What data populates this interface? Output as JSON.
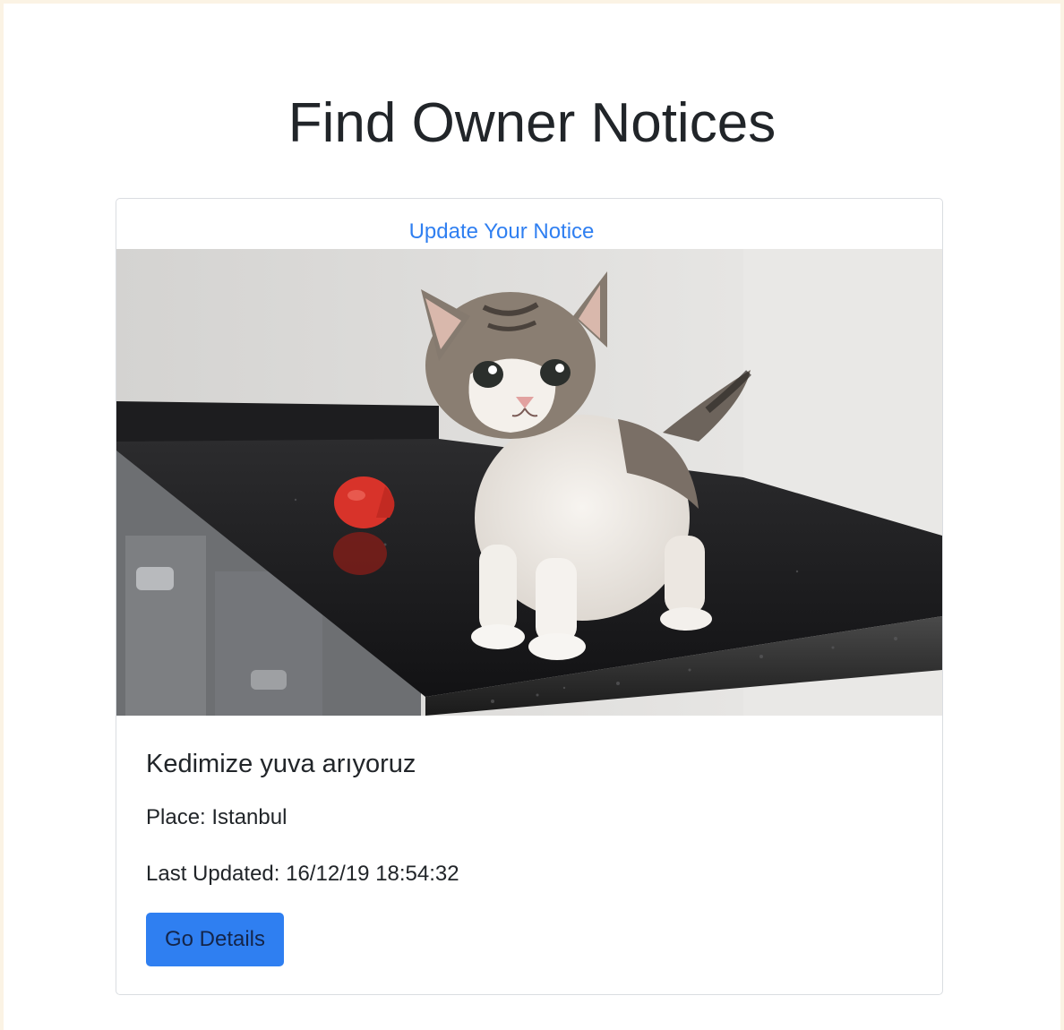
{
  "header": {
    "title": "Find Owner Notices"
  },
  "notice": {
    "update_link": "Update Your Notice",
    "image_alt": "kitten-photo",
    "title": "Kedimize yuva arıyoruz",
    "place": "Place: Istanbul",
    "last_updated": "Last Updated: 16/12/19 18:54:32",
    "details_button": "Go Details"
  },
  "colors": {
    "accent": "#2f7ff1",
    "background": "#fbf3e4",
    "text": "#212529"
  }
}
